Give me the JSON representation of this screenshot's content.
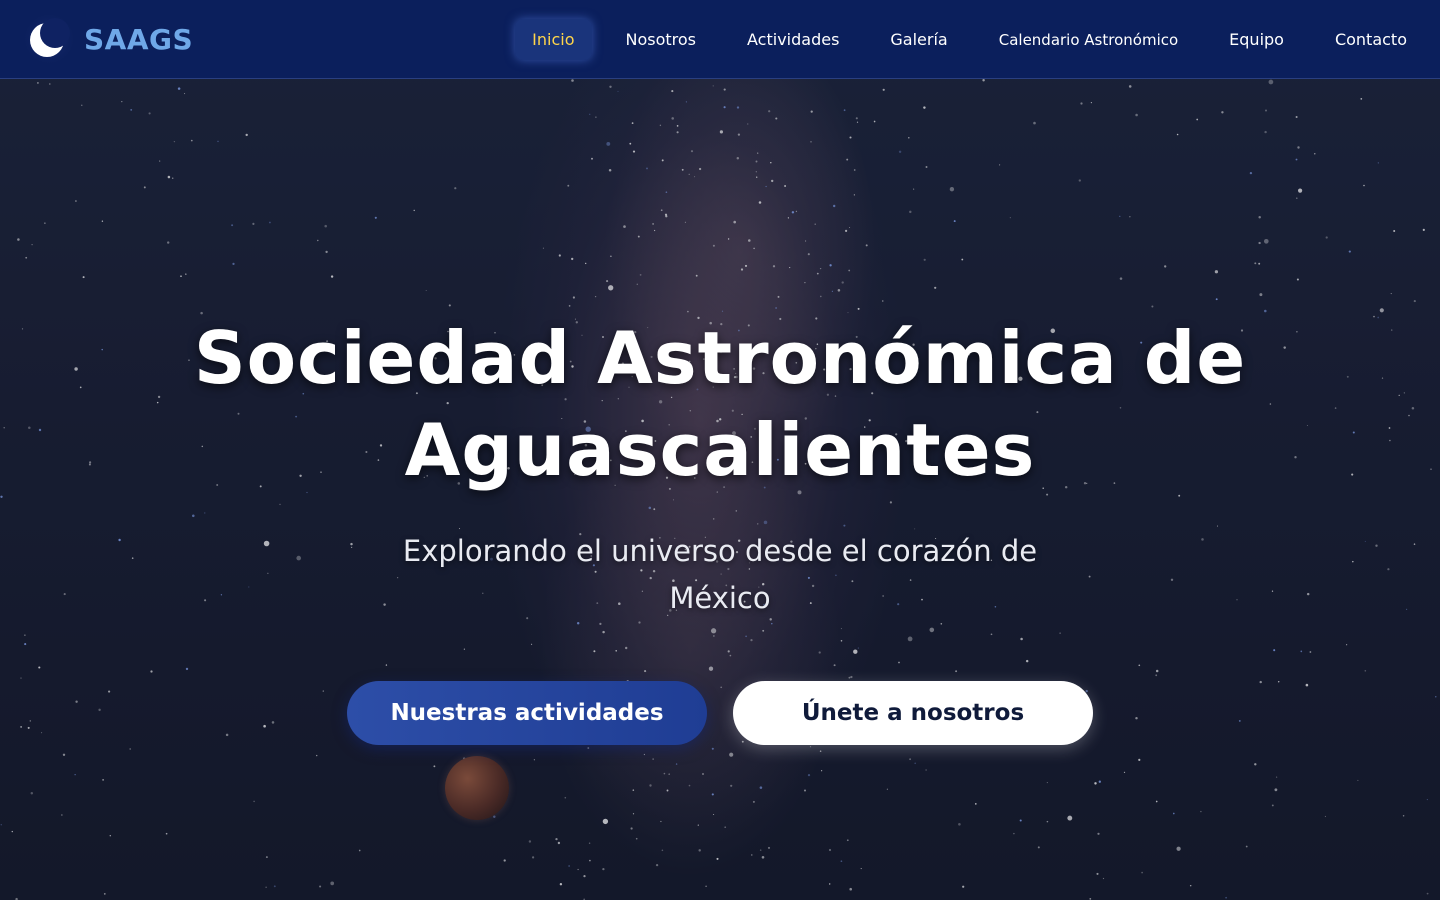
{
  "brand": {
    "name": "SAAGS",
    "logo_icon": "crescent-moon-icon"
  },
  "nav": {
    "items": [
      {
        "label": "Inicio",
        "active": true
      },
      {
        "label": "Nosotros",
        "active": false
      },
      {
        "label": "Actividades",
        "active": false
      },
      {
        "label": "Galería",
        "active": false
      },
      {
        "label": "Calendario Astronómico",
        "active": false
      },
      {
        "label": "Equipo",
        "active": false
      },
      {
        "label": "Contacto",
        "active": false
      }
    ]
  },
  "hero": {
    "title_line1": "Sociedad Astronómica de",
    "title_line2": "Aguascalientes",
    "subtitle": "Explorando el universo desde el corazón de México",
    "primary_button": "Nuestras actividades",
    "secondary_button": "Únete a nosotros"
  },
  "colors": {
    "navbar_bg": "#0b1f5c",
    "brand_text": "#6fa8e8",
    "active_link": "#ffd54a",
    "primary_button": "#2d4ea8",
    "secondary_button": "#ffffff"
  }
}
